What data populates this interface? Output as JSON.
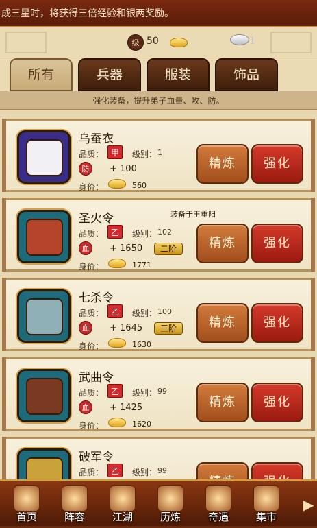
{
  "banner": {
    "text": "成三星时，将获得三倍经验和银两奖励。"
  },
  "topbar": {
    "level_icon": "级",
    "level": "50",
    "silver_partial": "1"
  },
  "tabs": [
    {
      "label": "所有",
      "active": true
    },
    {
      "label": "兵器",
      "active": false
    },
    {
      "label": "服装",
      "active": false
    },
    {
      "label": "饰品",
      "active": false
    }
  ],
  "hint": "强化装备，提升弟子血量、攻、防。",
  "labels": {
    "quality": "品质：",
    "level": "级别：",
    "price": "身价："
  },
  "buttons": {
    "refine": "精炼",
    "enhance": "强化"
  },
  "items": [
    {
      "name": "乌蚕衣",
      "quality_mark": "甲",
      "level": "1",
      "stat_icon": "防",
      "stat": "+ 100",
      "stage": "",
      "price": "560",
      "equipped_note": "",
      "icon": "white-robe-icon",
      "bg": "#3a2d8a"
    },
    {
      "name": "圣火令",
      "quality_mark": "乙",
      "level": "102",
      "stat_icon": "血",
      "stat": "+ 1650",
      "stage": "二阶",
      "price": "1771",
      "equipped_note": "装备于王重阳",
      "icon": "fire-token-icon",
      "bg": "#1d6b7a"
    },
    {
      "name": "七杀令",
      "quality_mark": "乙",
      "level": "100",
      "stat_icon": "血",
      "stat": "+ 1645",
      "stage": "三阶",
      "price": "1630",
      "equipped_note": "",
      "icon": "jade-token-icon",
      "bg": "#1d6b7a"
    },
    {
      "name": "武曲令",
      "quality_mark": "乙",
      "level": "99",
      "stat_icon": "血",
      "stat": "+ 1425",
      "stage": "",
      "price": "1620",
      "equipped_note": "",
      "icon": "wood-token-icon",
      "bg": "#1d6b7a"
    },
    {
      "name": "破军令",
      "quality_mark": "乙",
      "level": "99",
      "stat_icon": "",
      "stat": "",
      "stage": "",
      "price": "",
      "equipped_note": "",
      "icon": "gold-token-icon",
      "bg": "#1d6b7a"
    }
  ],
  "nav": [
    {
      "label": "首页",
      "icon": "home-icon"
    },
    {
      "label": "阵容",
      "icon": "team-icon"
    },
    {
      "label": "江湖",
      "icon": "jianghu-icon"
    },
    {
      "label": "历炼",
      "icon": "training-icon"
    },
    {
      "label": "奇遇",
      "icon": "adventure-icon"
    },
    {
      "label": "集市",
      "icon": "market-icon"
    }
  ]
}
